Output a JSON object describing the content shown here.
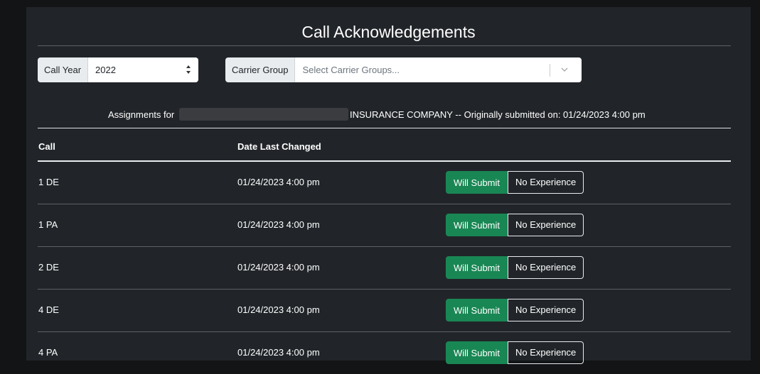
{
  "page": {
    "title": "Call Acknowledgements"
  },
  "filters": {
    "call_year_label": "Call Year",
    "call_year_value": "2022",
    "carrier_group_label": "Carrier Group",
    "carrier_group_placeholder": "Select Carrier Groups..."
  },
  "assignments": {
    "prefix": "Assignments for",
    "suffix": "INSURANCE COMPANY -- Originally submitted on: 01/24/2023 4:00 pm"
  },
  "table": {
    "headers": {
      "call": "Call",
      "date": "Date Last Changed"
    },
    "rows": [
      {
        "call": "1 DE",
        "date": "01/24/2023 4:00 pm",
        "submit_label": "Will Submit",
        "noexp_label": "No Experience"
      },
      {
        "call": "1 PA",
        "date": "01/24/2023 4:00 pm",
        "submit_label": "Will Submit",
        "noexp_label": "No Experience"
      },
      {
        "call": "2 DE",
        "date": "01/24/2023 4:00 pm",
        "submit_label": "Will Submit",
        "noexp_label": "No Experience"
      },
      {
        "call": "4 DE",
        "date": "01/24/2023 4:00 pm",
        "submit_label": "Will Submit",
        "noexp_label": "No Experience"
      },
      {
        "call": "4 PA",
        "date": "01/24/2023 4:00 pm",
        "submit_label": "Will Submit",
        "noexp_label": "No Experience"
      }
    ]
  },
  "colors": {
    "accent_green": "#198754",
    "panel_bg": "#212529",
    "page_bg": "#121416"
  },
  "icons": {
    "year_select": "sort-arrows-icon",
    "carrier_dropdown": "chevron-down-icon"
  }
}
